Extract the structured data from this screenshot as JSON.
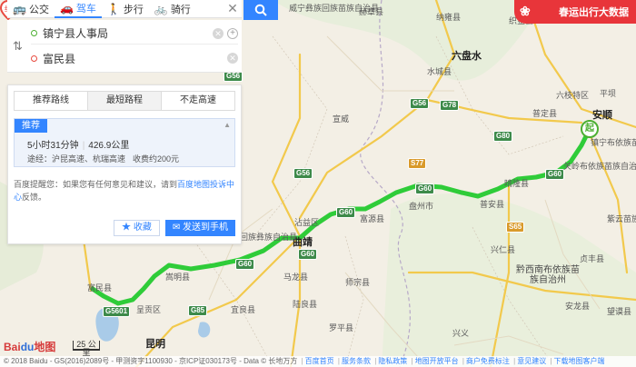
{
  "search": {
    "modes": [
      {
        "label": "公交",
        "icon": "bus-icon"
      },
      {
        "label": "驾车",
        "icon": "car-icon"
      },
      {
        "label": "步行",
        "icon": "walk-icon"
      },
      {
        "label": "骑行",
        "icon": "bike-icon"
      }
    ],
    "active_mode": "驾车",
    "start": "镇宁县人事局",
    "end": "富民县"
  },
  "panel": {
    "tabs": [
      "推荐路线",
      "最短路程",
      "不走高速"
    ],
    "active_tab": "最短路程",
    "route": {
      "badge": "推荐",
      "time": "5小时31分钟",
      "distance": "426.9公里",
      "via": "途经：沪昆高速、杭瑞高速",
      "toll": "收费约200元"
    },
    "tip_prefix": "百度提醒您：如果您有任何意见和建议，请到",
    "tip_link": "百度地图投诉中心",
    "tip_suffix": "反馈。",
    "favorite": "收藏",
    "send": "发送到手机"
  },
  "banner": {
    "label": "春运出行大数据"
  },
  "map": {
    "labels": [
      {
        "text": "威宁彝族回族苗族自治县",
        "kind": "normal"
      },
      {
        "text": "赫章县",
        "kind": "normal"
      },
      {
        "text": "纳雍县",
        "kind": "normal"
      },
      {
        "text": "织金县",
        "kind": "normal"
      },
      {
        "text": "六盘水",
        "kind": "city"
      },
      {
        "text": "水城县",
        "kind": "normal"
      },
      {
        "text": "宣威",
        "kind": "normal"
      },
      {
        "text": "六枝特区",
        "kind": "normal"
      },
      {
        "text": "安顺",
        "kind": "city"
      },
      {
        "text": "镇宁布依族苗族自治县",
        "kind": "normal"
      },
      {
        "text": "关岭布依族苗族自治县",
        "kind": "normal"
      },
      {
        "text": "普定县",
        "kind": "normal"
      },
      {
        "text": "平坝",
        "kind": "normal"
      },
      {
        "text": "晴隆县",
        "kind": "normal"
      },
      {
        "text": "普安县",
        "kind": "normal"
      },
      {
        "text": "盘州市",
        "kind": "normal"
      },
      {
        "text": "富源县",
        "kind": "normal"
      },
      {
        "text": "沾益区",
        "kind": "normal"
      },
      {
        "text": "曲靖",
        "kind": "city"
      },
      {
        "text": "马龙县",
        "kind": "normal"
      },
      {
        "text": "寻甸回族彝族自治县",
        "kind": "normal"
      },
      {
        "text": "嵩明县",
        "kind": "normal"
      },
      {
        "text": "富民县",
        "kind": "normal"
      },
      {
        "text": "呈贡区",
        "kind": "normal"
      },
      {
        "text": "昆明",
        "kind": "city"
      },
      {
        "text": "宜良县",
        "kind": "normal"
      },
      {
        "text": "陆良县",
        "kind": "normal"
      },
      {
        "text": "师宗县",
        "kind": "normal"
      },
      {
        "text": "罗平县",
        "kind": "normal"
      },
      {
        "text": "兴义",
        "kind": "normal"
      },
      {
        "text": "兴仁县",
        "kind": "normal"
      },
      {
        "text": "安龙县",
        "kind": "normal"
      },
      {
        "text": "贞丰县",
        "kind": "normal"
      },
      {
        "text": "黔西南布依族苗族自治州",
        "kind": "pref"
      },
      {
        "text": "望谟县",
        "kind": "normal"
      },
      {
        "text": "紫云苗族布依族自治县",
        "kind": "normal"
      }
    ],
    "shields": [
      "G56",
      "G56",
      "G60",
      "G60",
      "G60",
      "G60",
      "G78",
      "S77",
      "G56",
      "G60",
      "G80",
      "S65",
      "G5601",
      "G85"
    ],
    "start_pin": "起",
    "end_pin": "终"
  },
  "bottom": {
    "logo_left": "Bai",
    "logo_paw": "du",
    "logo_right": "地图",
    "scale": "25 公里",
    "copyright": "© 2018 Baidu - GS(2016)2089号 - 甲测资字1100930 - 京ICP证030173号 - Data © 长地万方",
    "links": [
      "百度首页",
      "服务条款",
      "隐私政策",
      "地图开放平台",
      "商户免费标注",
      "意见建议",
      "下载地图客户端"
    ]
  }
}
